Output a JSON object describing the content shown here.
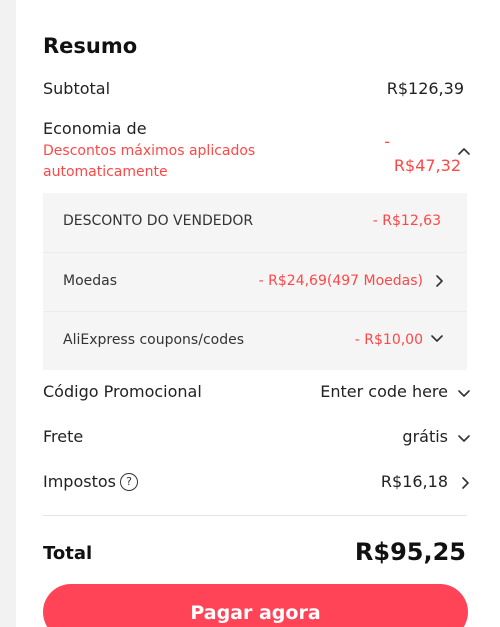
{
  "summary": {
    "title": "Resumo",
    "subtotal_label": "Subtotal",
    "subtotal_value": "R$126,39",
    "savings_label": "Economia de",
    "savings_note_line1": "Descontos máximos aplicados",
    "savings_note_line2": "automaticamente",
    "savings_dash": "-",
    "savings_value": "R$47,32",
    "discounts": [
      {
        "label": "DESCONTO DO VENDEDOR",
        "value": "- R$12,63"
      },
      {
        "label": "Moedas",
        "value": "- R$24,69(497 Moedas)"
      },
      {
        "label": "AliExpress coupons/codes",
        "value": "- R$10,00"
      }
    ],
    "promo_label": "Código Promocional",
    "promo_value": "Enter code here",
    "shipping_label": "Frete",
    "shipping_value": "grátis",
    "tax_label": "Impostos",
    "tax_help": "?",
    "tax_value": "R$16,18",
    "total_label": "Total",
    "total_value": "R$95,25",
    "pay_button": "Pagar agora"
  },
  "colors": {
    "accent_red": "#ff4747",
    "button_red": "#ff4458"
  },
  "icons": [
    "chevron-up-icon",
    "chevron-right-icon",
    "chevron-down-icon",
    "help-circle-icon"
  ]
}
